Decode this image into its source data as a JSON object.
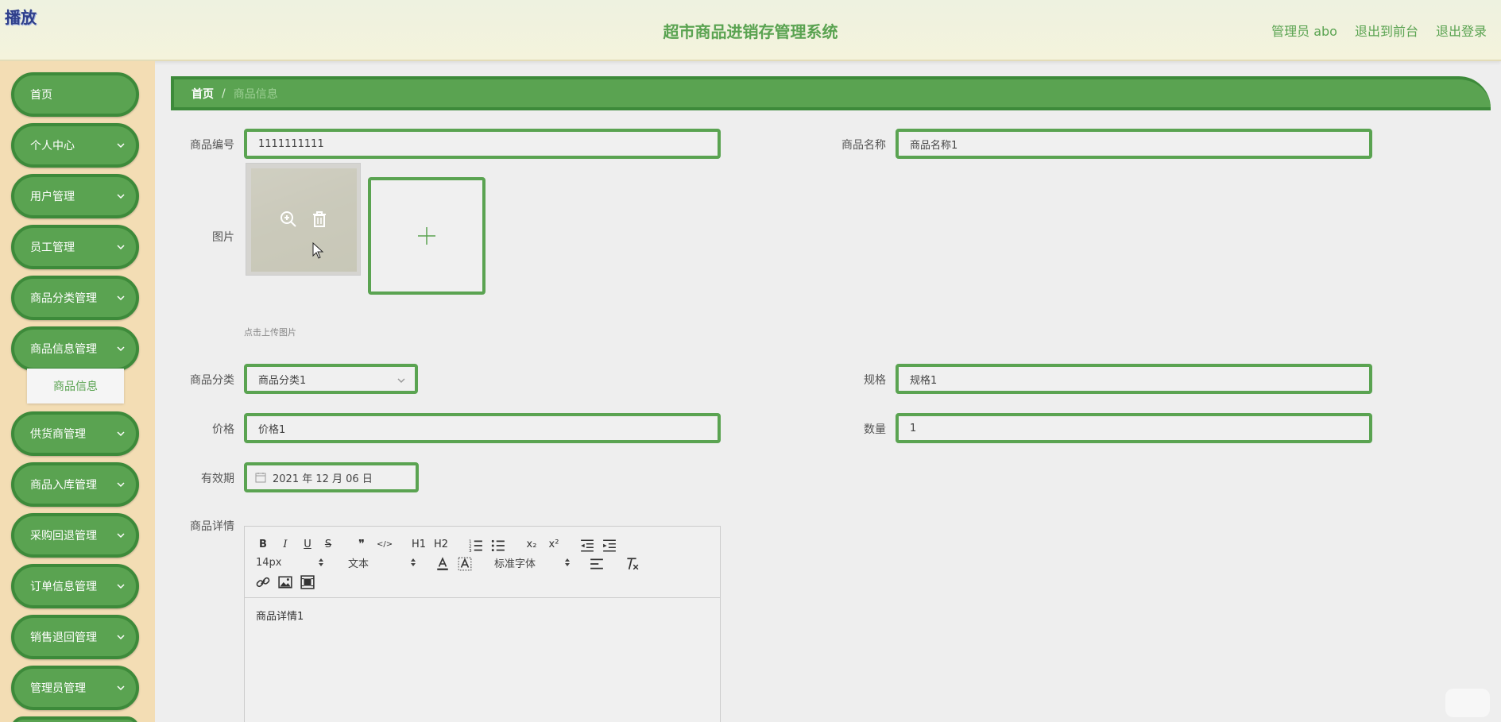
{
  "header": {
    "corner_label": "播放",
    "title": "超市商品进销存管理系统",
    "user": "管理员 abo",
    "links": [
      "退出到前台",
      "退出登录"
    ]
  },
  "sidebar": {
    "items": [
      "首页",
      "个人中心",
      "用户管理",
      "员工管理",
      "商品分类管理",
      "商品信息管理",
      "供货商管理",
      "商品入库管理",
      "采购回退管理",
      "订单信息管理",
      "销售退回管理",
      "管理员管理"
    ],
    "submenu": "商品信息"
  },
  "breadcrumb": {
    "home": "首页",
    "separator": "/",
    "current": "商品信息"
  },
  "form": {
    "code_label": "商品编号",
    "code_value": "1111111111",
    "name_label": "商品名称",
    "name_value": "商品名称1",
    "image_label": "图片",
    "upload_hint": "点击上传图片",
    "category_label": "商品分类",
    "category_value": "商品分类1",
    "spec_label": "规格",
    "spec_value": "规格1",
    "price_label": "价格",
    "price_value": "价格1",
    "qty_label": "数量",
    "qty_value": "1",
    "expiry_label": "有效期",
    "expiry_value": "2021 年 12 月 06 日",
    "detail_label": "商品详情"
  },
  "editor": {
    "row1": [
      "B",
      "I",
      "U",
      "S",
      "❞",
      "</>",
      "H1",
      "H2",
      "ol",
      "ul",
      "x₂",
      "x²",
      "outdent",
      "indent"
    ],
    "font_size": "14px",
    "header_select": "文本",
    "font_family": "标准字体",
    "content": "商品详情1"
  },
  "colors": {
    "accent": "#5aa351",
    "accent_dark": "#3d8a3a",
    "sidebar_bg": "#f3ddb4",
    "page_bg": "#eeeeee"
  }
}
